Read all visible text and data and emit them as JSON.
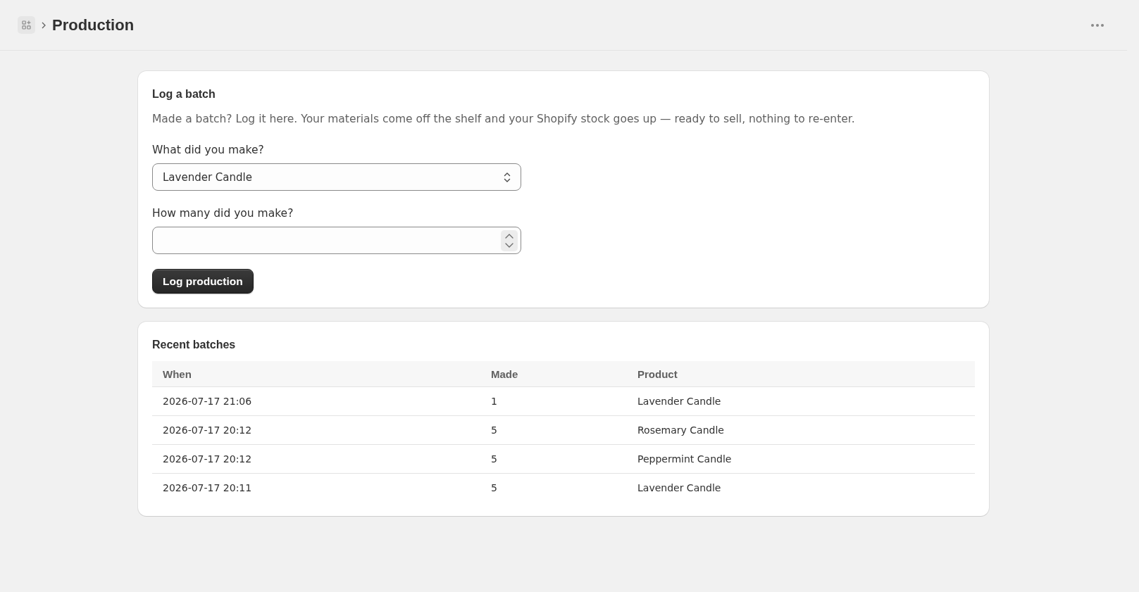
{
  "header": {
    "title": "Production"
  },
  "log_card": {
    "title": "Log a batch",
    "description": "Made a batch? Log it here. Your materials come off the shelf and your Shopify stock goes up — ready to sell, nothing to re-enter.",
    "fields": [
      {
        "kind": "select",
        "label": "What did you make?",
        "value": "Lavender Candle"
      },
      {
        "kind": "number",
        "label": "How many did you make?"
      }
    ],
    "submit_button": "Log production"
  },
  "recent_card": {
    "title": "Recent batches",
    "table": {
      "columns": [
        "When",
        "Made",
        "Product"
      ],
      "rows": [
        [
          "2026-07-17 21:06",
          "1",
          "Lavender Candle"
        ],
        [
          "2026-07-17 20:12",
          "5",
          "Rosemary Candle"
        ],
        [
          "2026-07-17 20:12",
          "5",
          "Peppermint Candle"
        ],
        [
          "2026-07-17 20:11",
          "5",
          "Lavender Candle"
        ]
      ]
    }
  }
}
